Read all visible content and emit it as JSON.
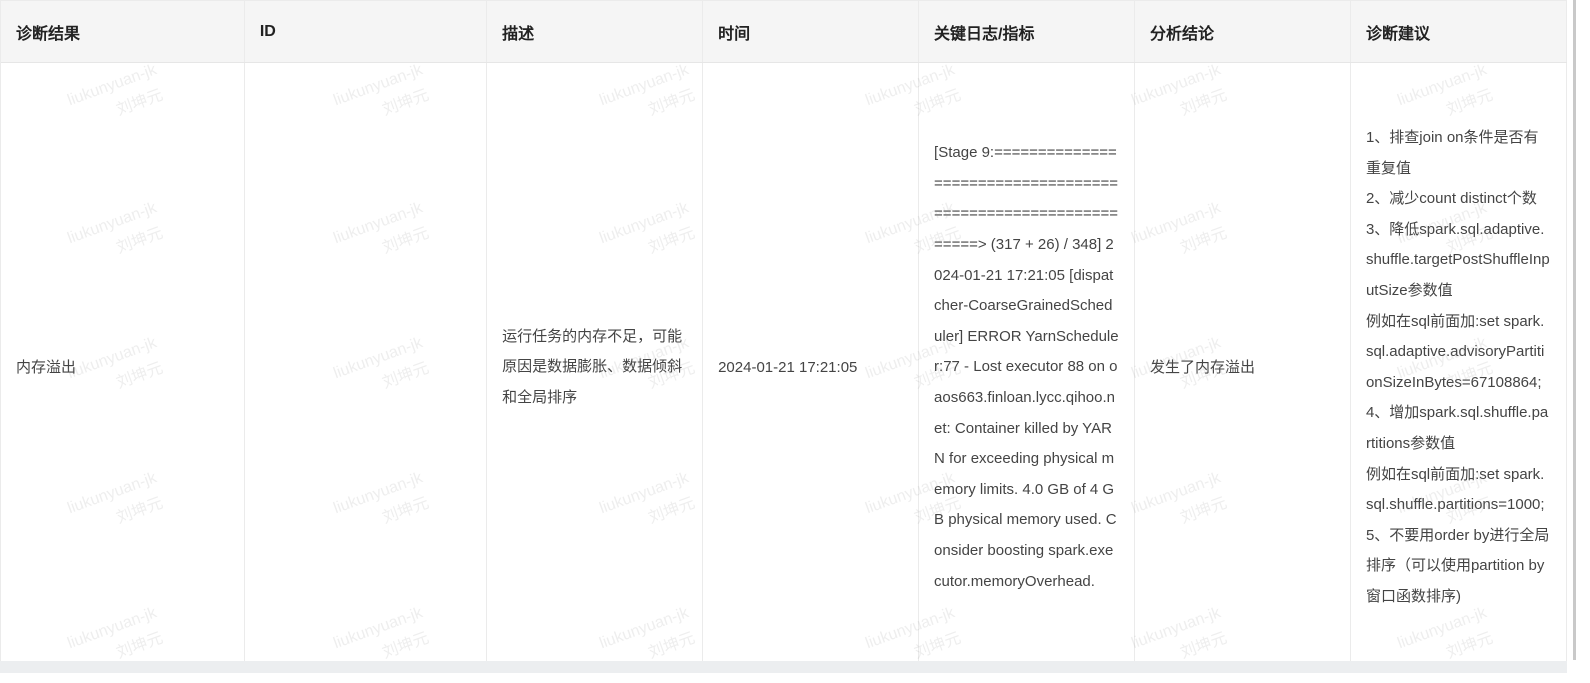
{
  "table": {
    "headers": [
      "诊断结果",
      "ID",
      "描述",
      "时间",
      "关键日志/指标",
      "分析结论",
      "诊断建议"
    ],
    "row": {
      "result": "内存溢出",
      "id": "",
      "description": "运行任务的内存不足，可能原因是数据膨胀、数据倾斜和全局排序",
      "time": "2024-01-21 17:21:05",
      "log": "[Stage 9:=============================================================> (317 + 26) / 348] 2024-01-21 17:21:05 [dispatcher-CoarseGrainedScheduler] ERROR YarnScheduler:77 - Lost executor 88 on oaos663.finloan.lycc.qihoo.net: Container killed by YARN for exceeding physical memory limits. 4.0 GB of 4 GB physical memory used. Consider boosting spark.executor.memoryOverhead.",
      "conclusion": "发生了内存溢出",
      "advice": [
        "1、排查join on条件是否有重复值",
        "2、减少count distinct个数",
        "3、降低spark.sql.adaptive.shuffle.targetPostShuffleInputSize参数值",
        "例如在sql前面加:set spark.sql.adaptive.advisoryPartitionSizeInBytes=67108864;",
        "4、增加spark.sql.shuffle.partitions参数值",
        "例如在sql前面加:set spark.sql.shuffle.partitions=1000;",
        "5、不要用order by进行全局排序（可以使用partition by窗口函数排序)"
      ]
    }
  },
  "watermark": {
    "line1": "liukunyuan-jk",
    "line2": "刘坤元"
  }
}
